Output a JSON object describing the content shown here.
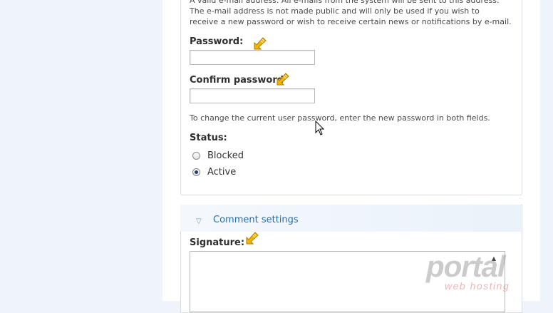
{
  "account": {
    "email_description": [
      "A valid e-mail address. All e-mails from the system will be sent to this address.",
      "The e-mail address is not made public and will only be used if you wish to",
      "receive a new password or wish to receive certain news or notifications by e-mail."
    ],
    "password_label": "Password:",
    "password_value": "",
    "confirm_password_label": "Confirm password",
    "confirm_password_value": "",
    "password_help": "To change the current user password, enter the new password in both fields.",
    "status_label": "Status:",
    "status_options": [
      {
        "label": "Blocked",
        "checked": false
      },
      {
        "label": "Active",
        "checked": true
      }
    ]
  },
  "comment_settings": {
    "legend": "Comment settings",
    "signature_label": "Signature:",
    "signature_value": ""
  },
  "watermark": {
    "main_text": "portal",
    "sub_text": "web hosting"
  },
  "colors": {
    "link": "#1f6fb5",
    "pointer_arrow": "#f2b600",
    "page_background": "#eef4fa"
  },
  "icons": {
    "pointer_arrow": "yellow-arrow-icon",
    "cursor": "mouse-cursor-icon",
    "toggle": "collapse-triangle-icon"
  }
}
